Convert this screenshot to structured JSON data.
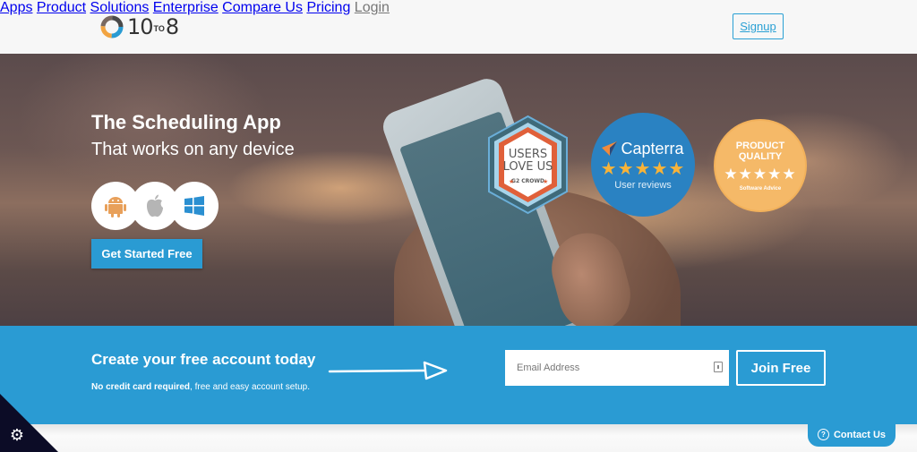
{
  "header": {
    "logo": {
      "left": "10",
      "mid": "TO",
      "right": "8"
    },
    "nav": [
      {
        "label": "Apps"
      },
      {
        "label": "Product"
      },
      {
        "label": "Solutions"
      },
      {
        "label": "Enterprise"
      },
      {
        "label": "Compare Us"
      },
      {
        "label": "Pricing"
      }
    ],
    "signup_label": "Signup",
    "login_label": "Login"
  },
  "hero": {
    "title": "The Scheduling App",
    "subtitle": "That works on any device",
    "platforms": [
      {
        "name": "Android",
        "icon": "android-icon",
        "color": "#e8a05a"
      },
      {
        "name": "Apple",
        "icon": "apple-icon",
        "color": "#b5b5b5"
      },
      {
        "name": "Windows",
        "icon": "windows-icon",
        "color": "#2a8fd1"
      }
    ],
    "cta_label": "Get Started Free",
    "badges": {
      "g2": {
        "line1": "USERS",
        "line2": "LOVE US",
        "brand": "G2 CROWD"
      },
      "capterra": {
        "name": "Capterra",
        "stars": "★★★★★",
        "rating": 5,
        "sub": "User reviews"
      },
      "software_advice": {
        "title_line1": "PRODUCT",
        "title_line2": "QUALITY",
        "stars": "★★★★★",
        "rating": 5,
        "sub": "Software Advice"
      }
    }
  },
  "signup_band": {
    "title": "Create your free account today",
    "note_bold": "No credit card required",
    "note_rest": ", free and easy account setup.",
    "email_placeholder": "Email Address",
    "join_label": "Join Free"
  },
  "footer": {
    "contact_label": "Contact Us",
    "contact_icon": "?",
    "settings_icon": "gear-icon"
  },
  "colors": {
    "accent": "#2a9bd3",
    "capterra": "#2a82c2",
    "software_advice": "#f5b968",
    "g2_orange": "#e0603a",
    "corner": "#0c0c26"
  }
}
